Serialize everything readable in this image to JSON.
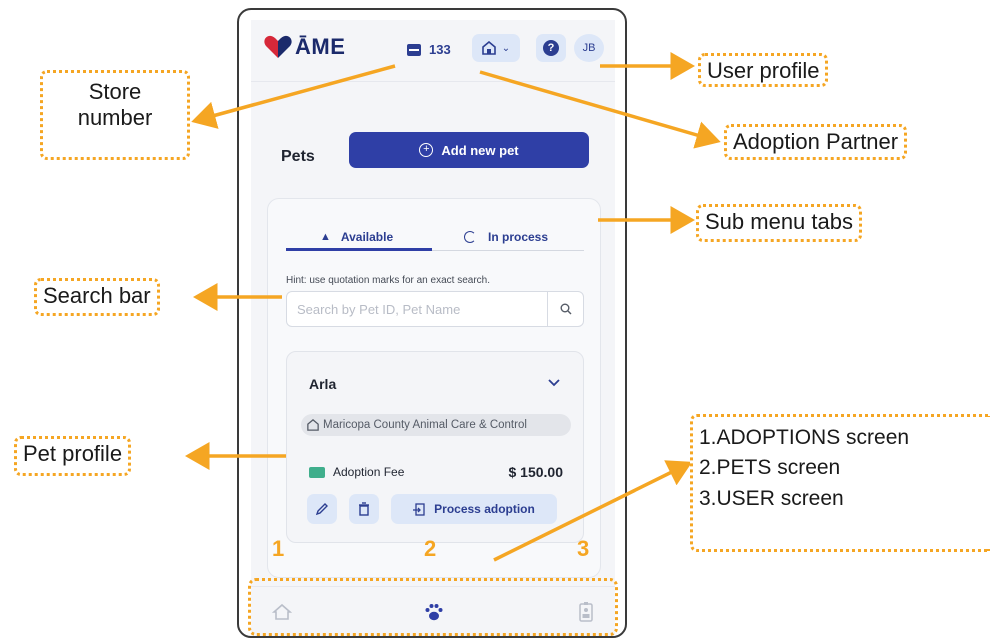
{
  "header": {
    "logo_text": "ĀME",
    "store_number": "133",
    "avatar_initials": "JB",
    "help_glyph": "?"
  },
  "pets_section": {
    "title": "Pets",
    "add_button_label": "Add new pet"
  },
  "tabs": [
    {
      "label": "Available",
      "active": true
    },
    {
      "label": "In process",
      "active": false
    }
  ],
  "search": {
    "hint": "Hint: use quotation marks for an exact search.",
    "placeholder": "Search by Pet ID, Pet Name"
  },
  "pet_card": {
    "name": "Arla",
    "shelter": "Maricopa County Animal Care & Control",
    "fee_label": "Adoption Fee",
    "fee_value": "$ 150.00",
    "process_button_label": "Process adoption"
  },
  "bottom_nav": [
    {
      "icon": "home-icon"
    },
    {
      "icon": "paw-icon"
    },
    {
      "icon": "user-badge-icon"
    }
  ],
  "annotations": {
    "store_line1": "Store",
    "store_line2": "number",
    "user_profile": "User profile",
    "adoption_partner": "Adoption Partner",
    "sub_menu_tabs": "Sub menu tabs",
    "search_bar": "Search bar",
    "pet_profile": "Pet profile",
    "screens": [
      "1.ADOPTIONS screen",
      "2.PETS screen",
      "3.USER screen"
    ],
    "numbers": [
      "1",
      "2",
      "3"
    ]
  },
  "colors": {
    "primary": "#2f3fa6",
    "light_button": "#dde7f8",
    "annotation_orange": "#f5a623",
    "logo_heart_red": "#d62839",
    "fee_green": "#3fae8c"
  }
}
